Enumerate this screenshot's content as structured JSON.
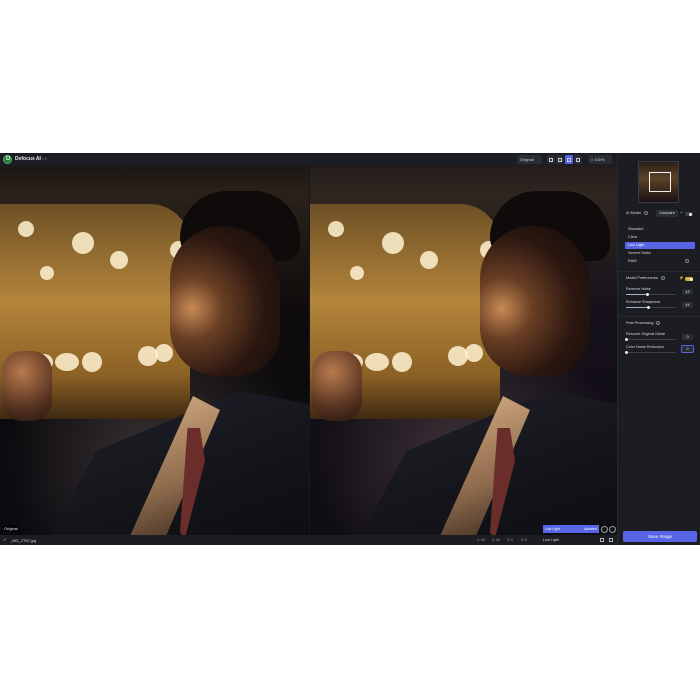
{
  "app": {
    "title": "Defocus AI",
    "version": "v1.7.0",
    "logo_letter": "D"
  },
  "toolbar": {
    "original_label": "Original",
    "zoom_label": "100%"
  },
  "photos": {
    "left_label": "Original"
  },
  "preview_chip": {
    "model": "Low Light",
    "status": "Updated"
  },
  "bottombar": {
    "file_name": "_MG_2787.jpg",
    "stats": [
      "1: 43",
      "2: 44",
      "3: 0",
      "4: 0"
    ],
    "model_label": "Low Light"
  },
  "panel": {
    "ai_model_label": "AI Model",
    "compare_label": "Compare",
    "models": [
      "Standard",
      "Clear",
      "Low Light",
      "Severe Noise",
      "RAW"
    ],
    "selected_model_index": 2,
    "model_preferences_label": "Model Preferences",
    "remove_noise_label": "Remove Noise",
    "remove_noise_value": "43",
    "enhance_sharpness_label": "Enhance Sharpness",
    "enhance_sharpness_value": "44",
    "post_processing_label": "Post Processing",
    "recover_detail_label": "Recover Original Detail",
    "recover_detail_value": "0",
    "color_noise_label": "Color Noise Reduction",
    "color_noise_value": "0",
    "save_label": "Save Image"
  },
  "colors": {
    "accent": "#5865e6",
    "toggle_on": "#e0b33a",
    "background": "#15171c"
  }
}
